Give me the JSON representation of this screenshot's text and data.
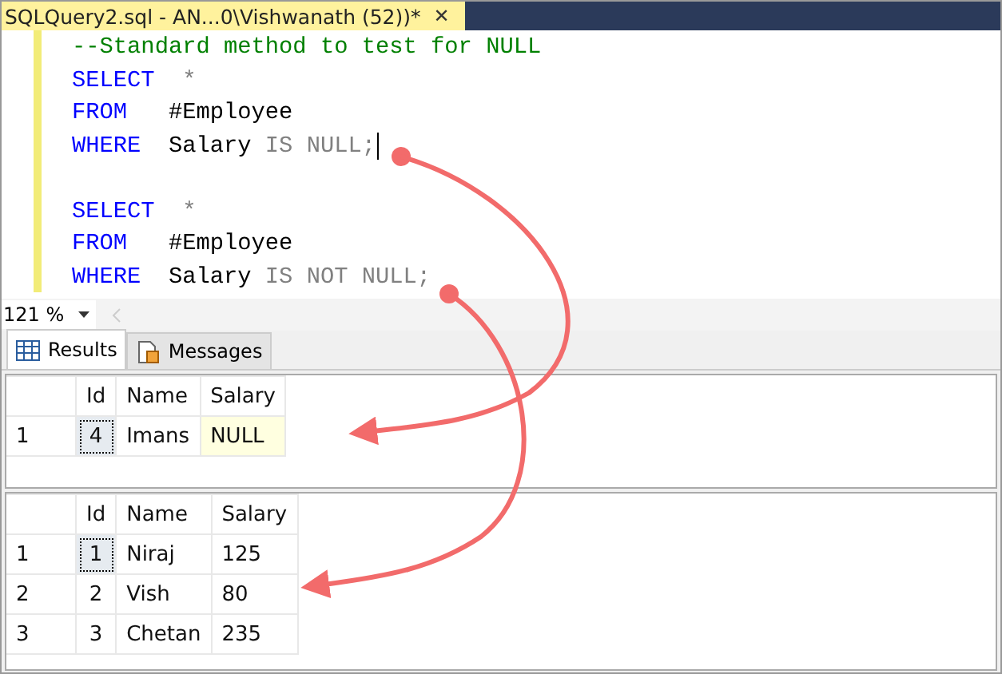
{
  "document_tab": {
    "title": "SQLQuery2.sql - AN...0\\Vishwanath (52))*",
    "close": "✕"
  },
  "editor": {
    "lines": [
      {
        "caret": false,
        "tokens": [
          {
            "kind": "comment",
            "text": "--Standard method to test for NULL"
          }
        ]
      },
      {
        "caret": false,
        "tokens": [
          {
            "kind": "keyword",
            "text": "SELECT"
          },
          {
            "kind": "operator",
            "text": "  *"
          }
        ]
      },
      {
        "caret": false,
        "tokens": [
          {
            "kind": "keyword",
            "text": "FROM"
          },
          {
            "kind": "plain",
            "text": "   #Employee"
          }
        ]
      },
      {
        "caret": true,
        "tokens": [
          {
            "kind": "keyword",
            "text": "WHERE"
          },
          {
            "kind": "plain",
            "text": "  Salary "
          },
          {
            "kind": "operator",
            "text": "IS NULL;"
          }
        ]
      },
      {
        "caret": false
      },
      {
        "caret": false,
        "tokens": [
          {
            "kind": "keyword",
            "text": "SELECT"
          },
          {
            "kind": "operator",
            "text": "  *"
          }
        ]
      },
      {
        "caret": false,
        "tokens": [
          {
            "kind": "keyword",
            "text": "FROM"
          },
          {
            "kind": "plain",
            "text": "   #Employee"
          }
        ]
      },
      {
        "caret": false,
        "tokens": [
          {
            "kind": "keyword",
            "text": "WHERE"
          },
          {
            "kind": "plain",
            "text": "  Salary "
          },
          {
            "kind": "operator",
            "text": "IS NOT NULL;"
          }
        ]
      }
    ]
  },
  "zoom": {
    "value": "121 %"
  },
  "result_tabs": [
    {
      "label": "Results",
      "selected": true
    },
    {
      "label": "Messages",
      "selected": false
    }
  ],
  "grids": [
    {
      "columns": [
        "Id",
        "Name",
        "Salary"
      ],
      "rows": [
        {
          "number": "1",
          "cells": [
            {
              "text": "4",
              "selected": true,
              "is_null": false
            },
            {
              "text": "Imans",
              "selected": false,
              "is_null": false
            },
            {
              "text": "NULL",
              "selected": false,
              "is_null": true
            }
          ]
        }
      ]
    },
    {
      "columns": [
        "Id",
        "Name",
        "Salary"
      ],
      "rows": [
        {
          "number": "1",
          "cells": [
            {
              "text": "1",
              "selected": true,
              "is_null": false
            },
            {
              "text": "Niraj",
              "selected": false,
              "is_null": false
            },
            {
              "text": "125",
              "selected": false,
              "is_null": false
            }
          ]
        },
        {
          "number": "2",
          "cells": [
            {
              "text": "2",
              "selected": false,
              "is_null": false
            },
            {
              "text": "Vish",
              "selected": false,
              "is_null": false
            },
            {
              "text": "80",
              "selected": false,
              "is_null": false
            }
          ]
        },
        {
          "number": "3",
          "cells": [
            {
              "text": "3",
              "selected": false,
              "is_null": false
            },
            {
              "text": "Chetan",
              "selected": false,
              "is_null": false
            },
            {
              "text": "235",
              "selected": false,
              "is_null": false
            }
          ]
        }
      ]
    }
  ]
}
